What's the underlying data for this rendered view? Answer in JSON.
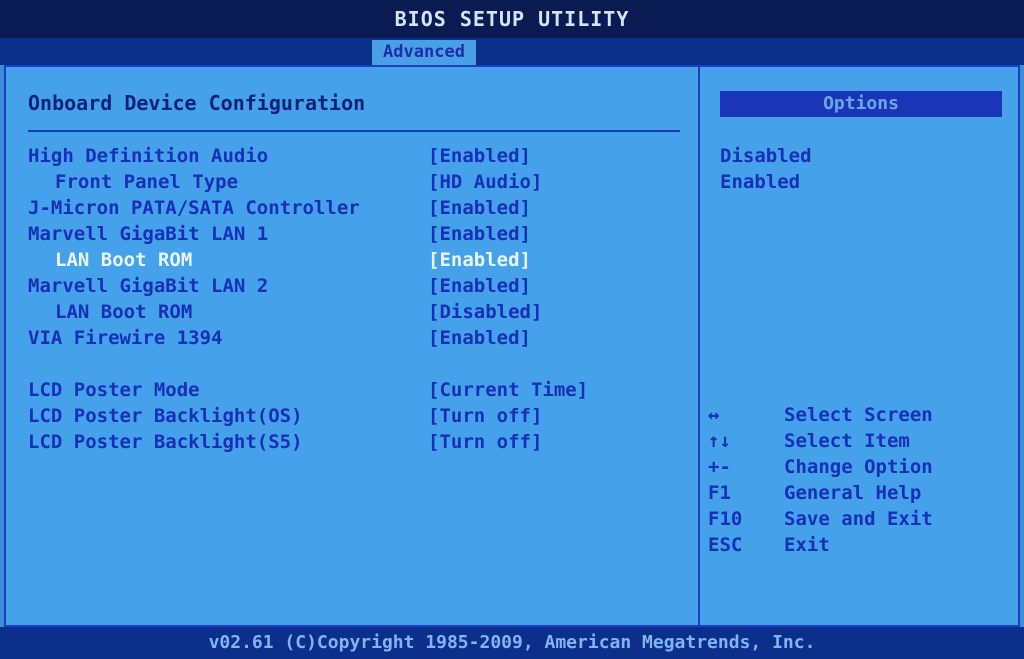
{
  "title": "BIOS SETUP UTILITY",
  "active_tab": "Advanced",
  "section_title": "Onboard Device Configuration",
  "settings": [
    {
      "label": "High Definition Audio",
      "value": "[Enabled]"
    },
    {
      "label": "Front Panel Type",
      "value": "[HD Audio]"
    },
    {
      "label": "J-Micron PATA/SATA Controller",
      "value": "[Enabled]"
    },
    {
      "label": "Marvell GigaBit LAN 1",
      "value": "[Enabled]"
    },
    {
      "label": "LAN Boot ROM",
      "value": "[Enabled]"
    },
    {
      "label": "Marvell GigaBit LAN 2",
      "value": "[Enabled]"
    },
    {
      "label": "LAN Boot ROM",
      "value": "[Disabled]"
    },
    {
      "label": "VIA Firewire 1394",
      "value": "[Enabled]"
    },
    {
      "label": "LCD Poster Mode",
      "value": "[Current Time]"
    },
    {
      "label": "LCD Poster Backlight(OS)",
      "value": "[Turn off]"
    },
    {
      "label": "LCD Poster Backlight(S5)",
      "value": "[Turn off]"
    }
  ],
  "options_panel": {
    "header": "Options",
    "items": [
      "Disabled",
      "Enabled"
    ]
  },
  "help": [
    {
      "key": "↔",
      "desc": "Select Screen"
    },
    {
      "key": "↑↓",
      "desc": "Select Item"
    },
    {
      "key": "+-",
      "desc": "Change Option"
    },
    {
      "key": "F1",
      "desc": "General Help"
    },
    {
      "key": "F10",
      "desc": "Save and Exit"
    },
    {
      "key": "ESC",
      "desc": "Exit"
    }
  ],
  "footer": "v02.61 (C)Copyright 1985-2009, American Megatrends, Inc.",
  "colors": {
    "background": "#45a1ea",
    "text": "#1730b8",
    "selected_text": "#e8f6ff",
    "bar": "#0d2f8c"
  }
}
